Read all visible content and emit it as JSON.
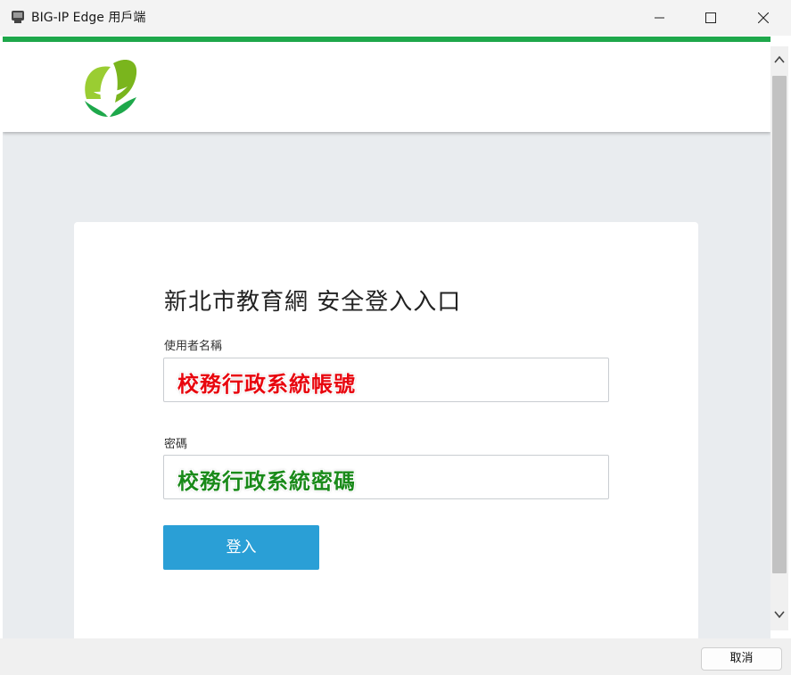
{
  "window": {
    "title": "BIG-IP Edge 用戶端"
  },
  "form": {
    "title": "新北市教育網 安全登入入口",
    "username_label": "使用者名稱",
    "username_value": "校務行政系統帳號",
    "password_label": "密碼",
    "password_value": "校務行政系統密碼",
    "login_label": "登入"
  },
  "footer": {
    "cancel_label": "取消"
  },
  "colors": {
    "accent_green": "#1ea84b",
    "button_blue": "#2a9fd6",
    "username_text": "#e8060e",
    "password_text": "#1a8a1a"
  },
  "icons": [
    "app-icon",
    "minimize-icon",
    "maximize-icon",
    "close-icon",
    "logo",
    "scroll-up-icon",
    "scroll-down-icon"
  ]
}
